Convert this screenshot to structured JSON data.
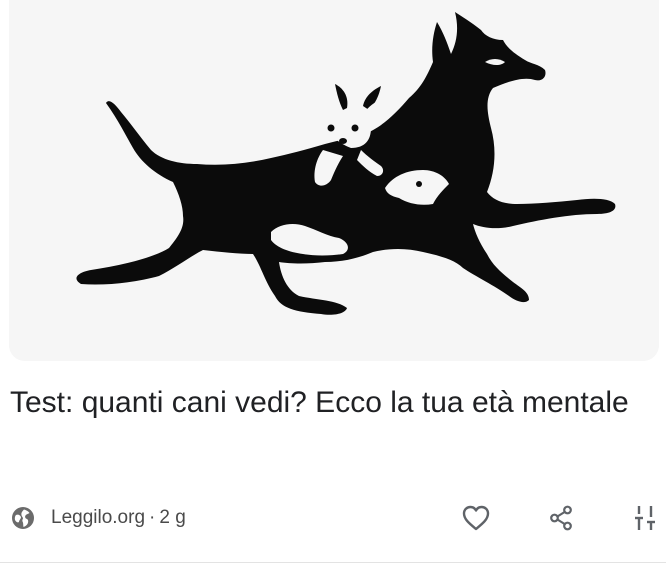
{
  "article": {
    "title": "Test: quanti cani vedi? Ecco la tua età mentale",
    "source": "Leggilo.org",
    "separator": "·",
    "age": "2 g",
    "image": {
      "background": "#f6f6f6",
      "silhouette_color": "#0b0b0b"
    }
  },
  "actions": {
    "like_icon": "heart-outline-icon",
    "share_icon": "share-icon",
    "more_icon": "tune-icon"
  },
  "colors": {
    "text": "#202124",
    "meta_text": "#4a4a4a",
    "icon": "#5f6368"
  }
}
